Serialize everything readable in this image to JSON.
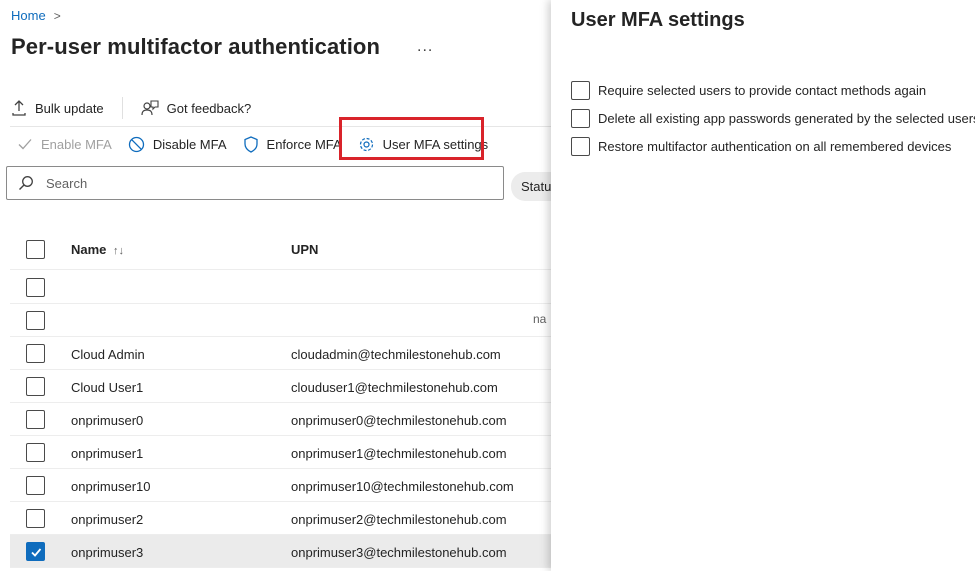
{
  "breadcrumb": {
    "home": "Home",
    "separator": ">"
  },
  "page": {
    "title": "Per-user multifactor authentication",
    "more": "..."
  },
  "toolbar": {
    "bulk_update": "Bulk update",
    "feedback": "Got feedback?",
    "enable_mfa": "Enable MFA",
    "disable_mfa": "Disable MFA",
    "enforce_mfa": "Enforce MFA",
    "user_mfa_settings": "User MFA settings"
  },
  "search": {
    "placeholder": "Search"
  },
  "filter": {
    "status_label": "Status"
  },
  "table": {
    "columns": {
      "name": "Name",
      "name_sort": "↑↓",
      "upn": "UPN"
    },
    "partial_cell": "na",
    "rows": [
      {
        "name": "",
        "upn": "",
        "checked": false
      },
      {
        "name": "",
        "upn": "",
        "checked": false
      },
      {
        "name": "Cloud Admin",
        "upn": "cloudadmin@techmilestonehub.com",
        "checked": false
      },
      {
        "name": "Cloud User1",
        "upn": "clouduser1@techmilestonehub.com",
        "checked": false
      },
      {
        "name": "onprimuser0",
        "upn": "onprimuser0@techmilestonehub.com",
        "checked": false
      },
      {
        "name": "onprimuser1",
        "upn": "onprimuser1@techmilestonehub.com",
        "checked": false
      },
      {
        "name": "onprimuser10",
        "upn": "onprimuser10@techmilestonehub.com",
        "checked": false
      },
      {
        "name": "onprimuser2",
        "upn": "onprimuser2@techmilestonehub.com",
        "checked": false
      },
      {
        "name": "onprimuser3",
        "upn": "onprimuser3@techmilestonehub.com",
        "checked": true
      }
    ]
  },
  "panel": {
    "title": "User MFA settings",
    "options": [
      "Require selected users to provide contact methods again",
      "Delete all existing app passwords generated by the selected users",
      "Restore multifactor authentication on all remembered devices"
    ]
  },
  "colors": {
    "accent": "#0f6cbd",
    "highlight_box": "#d9232a",
    "selected_row": "#ebebeb"
  }
}
